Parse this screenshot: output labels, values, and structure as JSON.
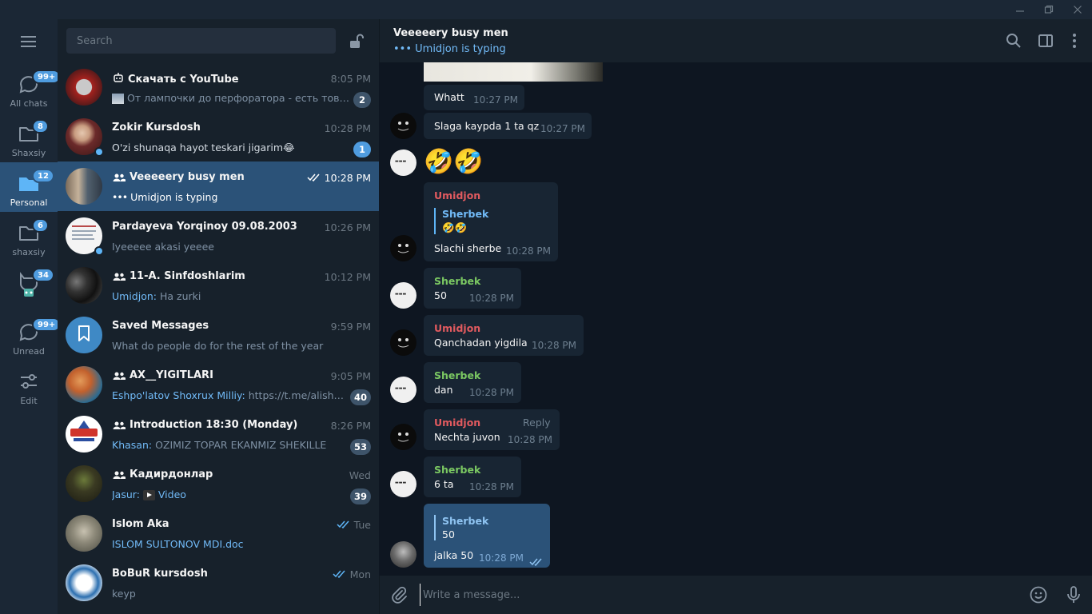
{
  "window": {
    "min_icon": "minimize-icon",
    "max_icon": "maximize-icon",
    "close_icon": "close-icon"
  },
  "folders": [
    {
      "label": "All chats",
      "badge": "99+",
      "icon": "chats-icon"
    },
    {
      "label": "Shaxsiy",
      "badge": "8",
      "icon": "folder-icon"
    },
    {
      "label": "Personal",
      "badge": "12",
      "icon": "folder-icon",
      "active": true
    },
    {
      "label": "shaxsiy",
      "badge": "6",
      "icon": "folder-icon"
    },
    {
      "label": "",
      "badge": "34",
      "icon": "cat-robot-icon"
    },
    {
      "label": "Unread",
      "badge": "99+",
      "icon": "unread-icon"
    },
    {
      "label": "Edit",
      "badge": "",
      "icon": "edit-sliders-icon"
    }
  ],
  "search": {
    "placeholder": "Search"
  },
  "chats": [
    {
      "name": "Скачать с YouTube",
      "time": "8:05 PM",
      "preview": "От лампочки до перфоратора - есть товар ...",
      "badge": "2",
      "type": "bot"
    },
    {
      "name": "Zokir Kursdosh",
      "time": "10:28 PM",
      "preview": "O'zi shunaqa hayot teskari jigarim😂",
      "badge": "1",
      "online": true
    },
    {
      "name": "Veeeeery busy men",
      "time": "10:28 PM",
      "preview": "Umidjon is typing",
      "type": "group",
      "active": true,
      "read": true
    },
    {
      "name": "Pardayeva Yorqinoy 09.08.2003",
      "time": "10:26 PM",
      "preview": "Iyeeeee akasi yeeee",
      "online": true
    },
    {
      "name": "11-A. Sinfdoshlarim",
      "time": "10:12 PM",
      "sender": "Umidjon",
      "preview": "Ha zurki",
      "type": "group"
    },
    {
      "name": "Saved Messages",
      "time": "9:59 PM",
      "preview": "What do people do for the rest of the year"
    },
    {
      "name": "AX__YIGITLARI",
      "time": "9:05 PM",
      "sender": "Eshpo'latov Shoxrux Milliy",
      "preview": "https://t.me/alisher_...",
      "badge": "40",
      "type": "group"
    },
    {
      "name": "Introduction 18:30 (Monday)",
      "time": "8:26 PM",
      "sender": "Khasan",
      "preview": "OZIMIZ TOPAR EKANMIZ SHEKILLE",
      "badge": "53",
      "type": "group"
    },
    {
      "name": "Кадирдонлар",
      "time": "Wed",
      "sender": "Jasur",
      "preview": "Video",
      "badge": "39",
      "type": "group"
    },
    {
      "name": "Islom Aka",
      "time": "Tue",
      "preview": "ISLOM SULTONOV MDI.doc",
      "read": true
    },
    {
      "name": "BoBuR kursdosh",
      "time": "Mon",
      "preview": "keyp",
      "read": true
    }
  ],
  "chat": {
    "title": "Veeeeery busy men",
    "status": "••• Umidjon is typing",
    "input_placeholder": "Write a message...",
    "messages": [
      {
        "text": "Whatt",
        "time": "10:27 PM"
      },
      {
        "text": "Slaga kaypda 1 ta qz",
        "time": "10:27 PM"
      },
      {
        "sticker": "🤣🤣"
      },
      {
        "sender": "Umidjon",
        "quote_name": "Sherbek",
        "quote_text": "🤣🤣",
        "text": "Slachi sherbe",
        "time": "10:28 PM"
      },
      {
        "sender": "Sherbek",
        "text": "50",
        "time": "10:28 PM"
      },
      {
        "sender": "Umidjon",
        "text": "Qanchadan yigdila",
        "time": "10:28 PM"
      },
      {
        "sender": "Sherbek",
        "text": "dan",
        "time": "10:28 PM"
      },
      {
        "sender": "Umidjon",
        "text": "Nechta juvon",
        "time": "10:28 PM",
        "reply_label": "Reply"
      },
      {
        "sender": "Sherbek",
        "text": "6 ta",
        "time": "10:28 PM"
      },
      {
        "quote_name": "Sherbek",
        "quote_text": "50",
        "text": "jalka 50",
        "time": "10:28 PM",
        "outgoing": true
      }
    ]
  },
  "colors": {
    "accent": "#5eb5f7",
    "active_row": "#2b5278",
    "sidebar": "#17212b",
    "background": "#0e1621",
    "red_name": "#e15a5f",
    "green_name": "#7bc862"
  }
}
